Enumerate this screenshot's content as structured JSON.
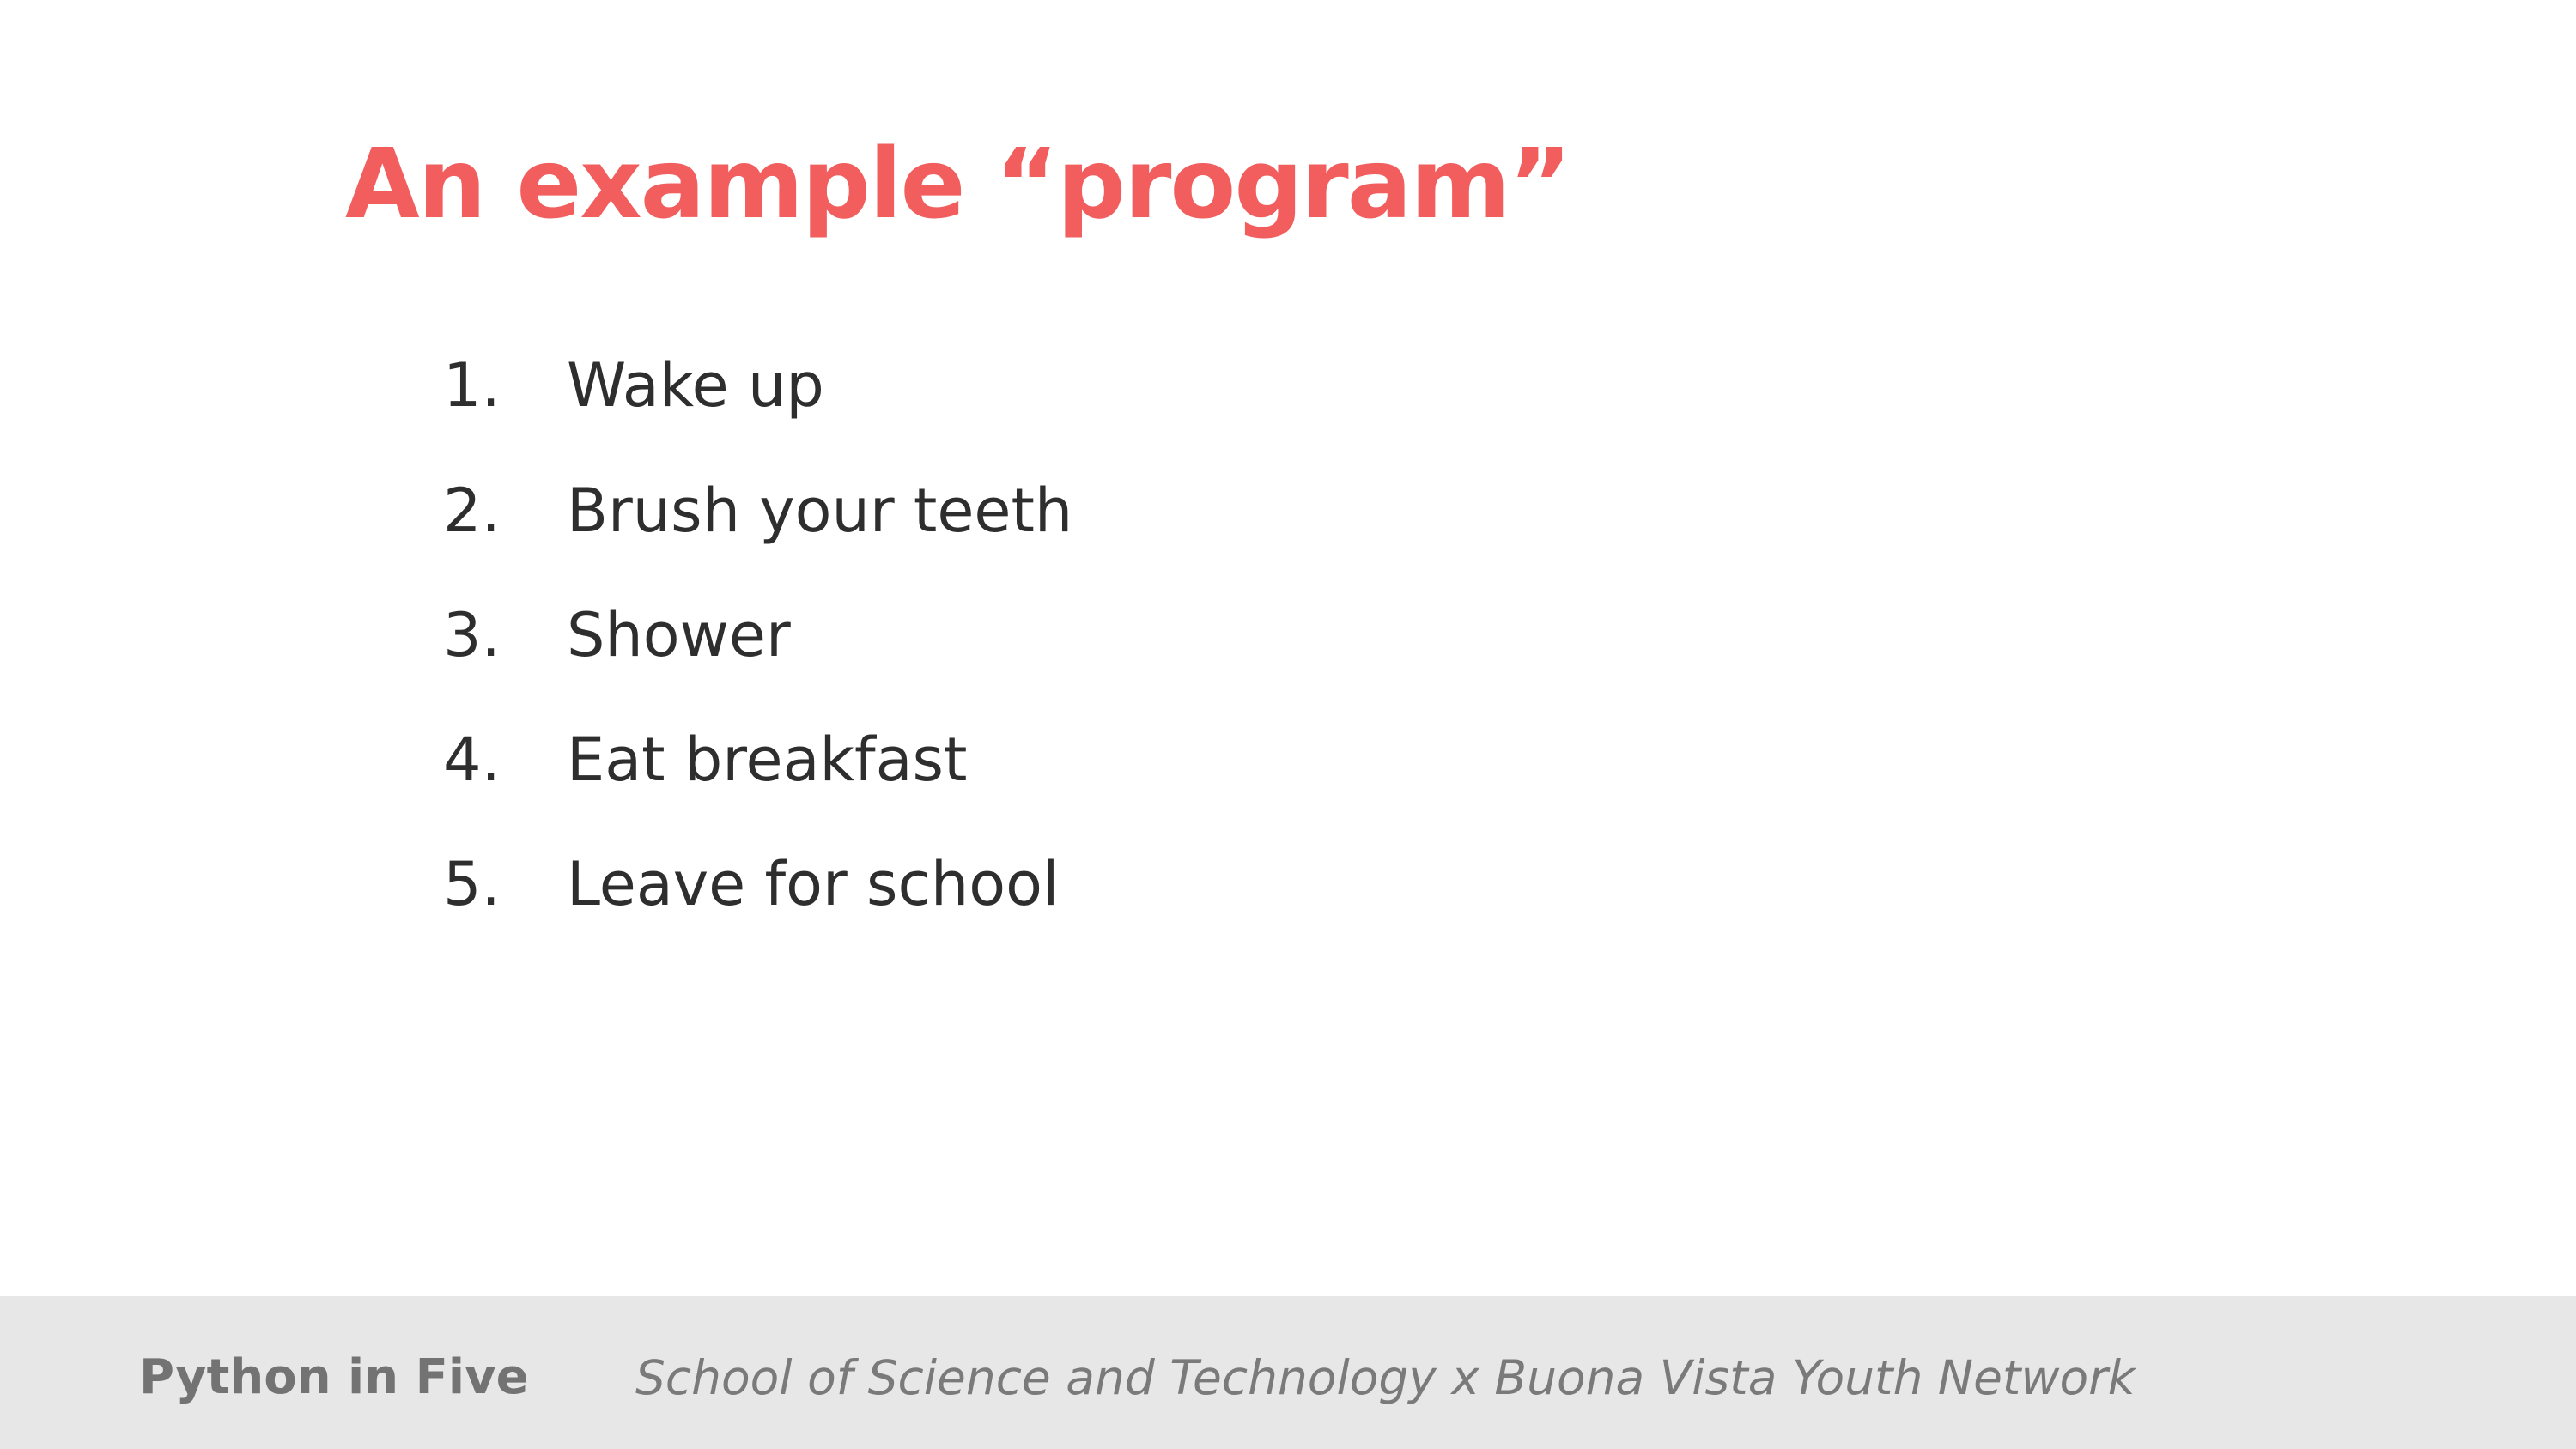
{
  "slide": {
    "title": "An example “program”",
    "steps": [
      {
        "number": "1.",
        "label": "Wake up"
      },
      {
        "number": "2.",
        "label": "Brush your teeth"
      },
      {
        "number": "3.",
        "label": "Shower"
      },
      {
        "number": "4.",
        "label": "Eat breakfast"
      },
      {
        "number": "5.",
        "label": "Leave for school"
      }
    ]
  },
  "footer": {
    "brand": "Python in Five",
    "credit": "School of Science and Technology x Buona Vista Youth Network"
  },
  "colors": {
    "title": "#f25e5e",
    "body_text": "#2e2e2e",
    "footer_background": "#e7e7e7",
    "footer_text": "#737373"
  }
}
